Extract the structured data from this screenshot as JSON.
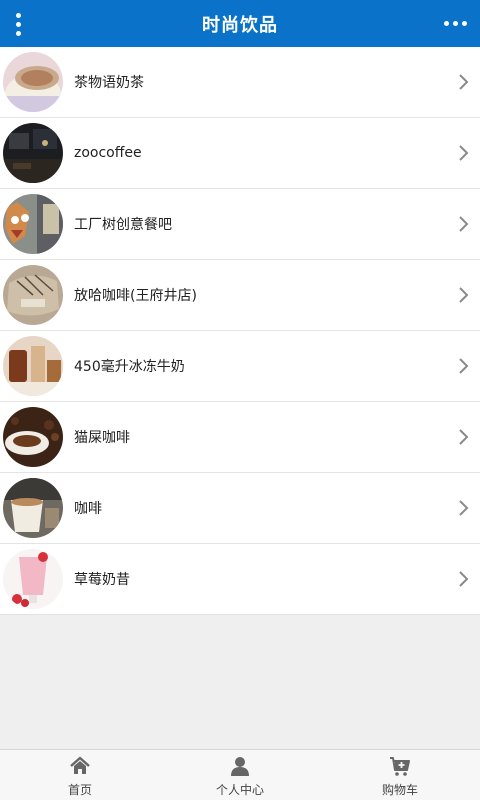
{
  "header": {
    "title": "时尚饮品"
  },
  "items": [
    {
      "label": "茶物语奶茶"
    },
    {
      "label": "zoocoffee"
    },
    {
      "label": "工厂树创意餐吧"
    },
    {
      "label": "放哈咖啡(王府井店)"
    },
    {
      "label": "450毫升冰冻牛奶"
    },
    {
      "label": "猫屎咖啡"
    },
    {
      "label": "咖啡"
    },
    {
      "label": "草莓奶昔"
    }
  ],
  "tabbar": {
    "home": "首页",
    "profile": "个人中心",
    "cart": "购物车"
  },
  "colors": {
    "header_bg": "#0a72c8",
    "page_bg": "#efefef"
  }
}
